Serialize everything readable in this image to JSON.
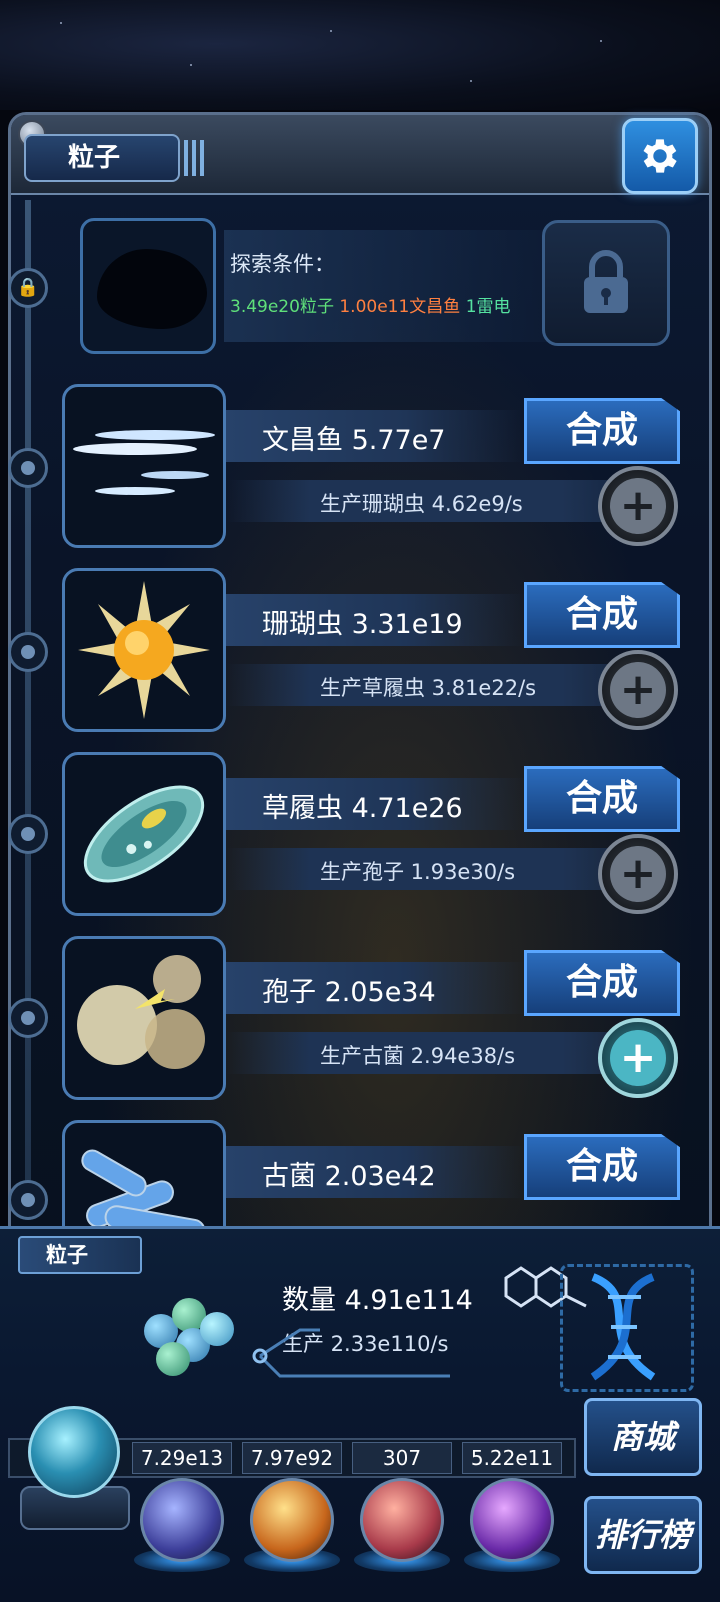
{
  "header": {
    "title": "粒子"
  },
  "locked": {
    "condition_title": "探索条件：",
    "req1": "3.49e20粒子",
    "req2": "1.00e11文昌鱼",
    "req3": "1雷电"
  },
  "units": [
    {
      "name": "文昌鱼 5.77e7",
      "produce": "生产珊瑚虫 4.62e9/s",
      "synth": "合成",
      "plus_active": false
    },
    {
      "name": "珊瑚虫 3.31e19",
      "produce": "生产草履虫 3.81e22/s",
      "synth": "合成",
      "plus_active": false
    },
    {
      "name": "草履虫 4.71e26",
      "produce": "生产孢子 1.93e30/s",
      "synth": "合成",
      "plus_active": false
    },
    {
      "name": "孢子 2.05e34",
      "produce": "生产古菌 2.94e38/s",
      "synth": "合成",
      "plus_active": true
    },
    {
      "name": "古菌 2.03e42",
      "produce": "",
      "synth": "合成",
      "plus_active": false
    }
  ],
  "bottom": {
    "tag": "粒子",
    "count": "数量 4.91e114",
    "production": "生产 2.33e110/s"
  },
  "resources": [
    "7.29e13",
    "7.97e92",
    "307",
    "5.22e11"
  ],
  "resource_partial": "4",
  "side_buttons": {
    "shop": "商城",
    "ranking": "排行榜"
  },
  "colors": {
    "accent": "#2b6cbd",
    "req1": "#5fe07a",
    "req2": "#ff8040",
    "req3": "#55e2a0"
  }
}
